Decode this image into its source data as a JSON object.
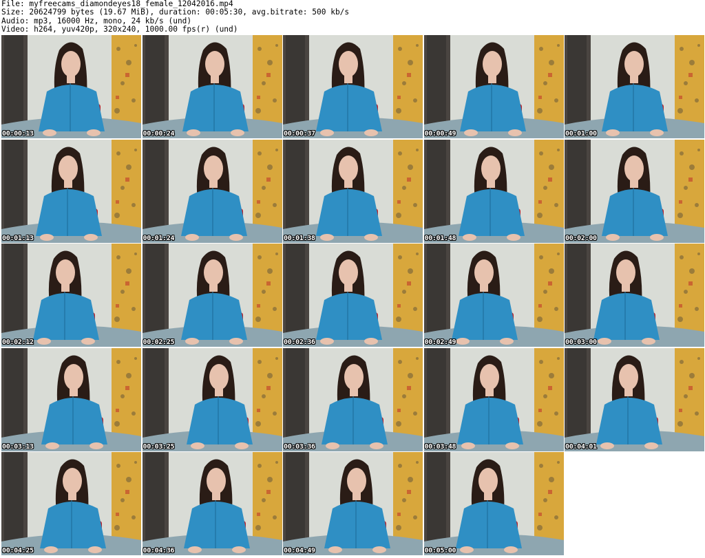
{
  "header": {
    "file_line": "File: myfreecams_diamondeyes18_female_12042016.mp4",
    "size_line": "Size: 20624799 bytes (19.67 MiB), duration: 00:05:30, avg.bitrate: 500 kb/s",
    "audio_line": "Audio: mp3, 16000 Hz, mono, 24 kb/s (und)",
    "video_line": "Video: h264, yuv420p, 320x240, 1000.00 fps(r) (und)"
  },
  "thumbnails": [
    {
      "timestamp": "00:00:13"
    },
    {
      "timestamp": "00:00:24"
    },
    {
      "timestamp": "00:00:37"
    },
    {
      "timestamp": "00:00:49"
    },
    {
      "timestamp": "00:01:00"
    },
    {
      "timestamp": "00:01:13"
    },
    {
      "timestamp": "00:01:24"
    },
    {
      "timestamp": "00:01:38"
    },
    {
      "timestamp": "00:01:48"
    },
    {
      "timestamp": "00:02:00"
    },
    {
      "timestamp": "00:02:12"
    },
    {
      "timestamp": "00:02:25"
    },
    {
      "timestamp": "00:02:36"
    },
    {
      "timestamp": "00:02:49"
    },
    {
      "timestamp": "00:03:00"
    },
    {
      "timestamp": "00:03:13"
    },
    {
      "timestamp": "00:03:25"
    },
    {
      "timestamp": "00:03:36"
    },
    {
      "timestamp": "00:03:48"
    },
    {
      "timestamp": "00:04:01"
    },
    {
      "timestamp": "00:04:25"
    },
    {
      "timestamp": "00:04:36"
    },
    {
      "timestamp": "00:04:49"
    },
    {
      "timestamp": "00:05:00"
    }
  ],
  "colors": {
    "wall": "#d9dcd6",
    "door": "#3a3734",
    "shirt": "#2f8fc4",
    "hair": "#2a1c16",
    "skin": "#e7c2ae",
    "chair": "#b8202a",
    "art": "#d8a73c",
    "desk": "#8ea6b0"
  }
}
